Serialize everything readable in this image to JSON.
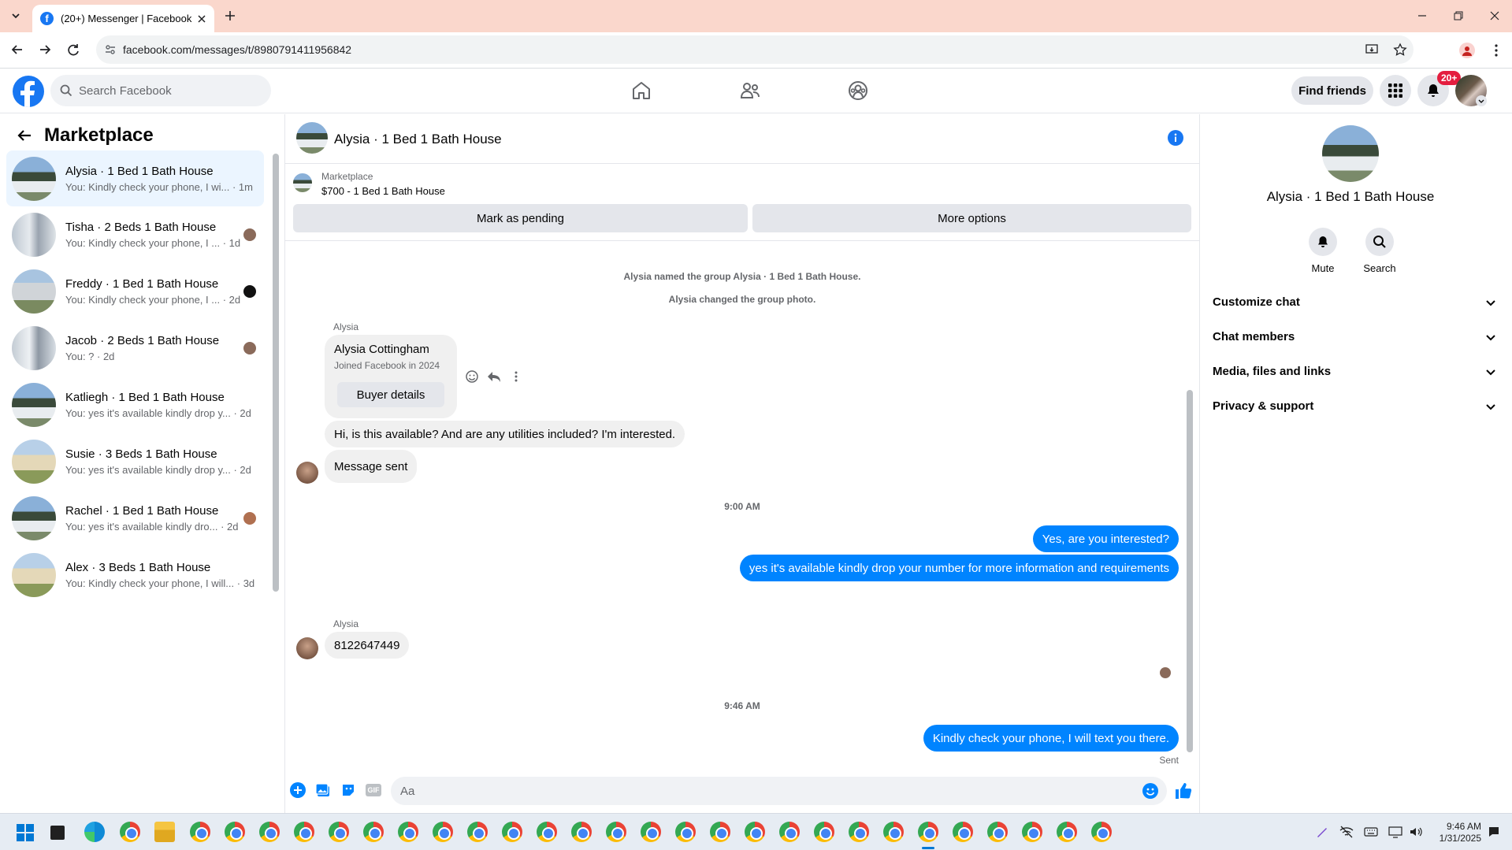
{
  "browser": {
    "tab_title": "(20+) Messenger | Facebook",
    "url": "facebook.com/messages/t/8980791411956842"
  },
  "header": {
    "search_placeholder": "Search Facebook",
    "find_friends": "Find friends",
    "notif_badge": "20+"
  },
  "sidebar": {
    "title": "Marketplace",
    "conversations": [
      {
        "name": "Alysia · 1 Bed 1 Bath House",
        "preview": "You: Kindly check your phone, I wi... · 1m",
        "selected": true
      },
      {
        "name": "Tisha · 2 Beds 1 Bath House",
        "preview": "You: Kindly check your phone, I ... · 1d"
      },
      {
        "name": "Freddy · 1 Bed 1 Bath House",
        "preview": "You: Kindly check your phone, I ... · 2d"
      },
      {
        "name": "Jacob · 2 Beds 1 Bath House",
        "preview": "You: ? · 2d"
      },
      {
        "name": "Katliegh · 1 Bed 1 Bath House",
        "preview": "You: yes it's available kindly drop y...  · 2d"
      },
      {
        "name": "Susie · 3 Beds 1 Bath House",
        "preview": "You: yes it's available kindly drop y...  · 2d"
      },
      {
        "name": "Rachel · 1 Bed 1 Bath House",
        "preview": "You: yes it's available kindly dro...  · 2d"
      },
      {
        "name": "Alex · 3 Beds 1 Bath House",
        "preview": "You: Kindly check your phone, I will... · 3d"
      }
    ]
  },
  "chat": {
    "title": "Alysia · 1 Bed 1 Bath House",
    "listing_source": "Marketplace",
    "listing_title": "$700 - 1 Bed 1 Bath House",
    "mark_pending": "Mark as pending",
    "more_options": "More options",
    "system_1": "Alysia named the group Alysia · 1 Bed 1 Bath House.",
    "system_2": "Alysia changed the group photo.",
    "sender_1": "Alysia",
    "card_name": "Alysia Cottingham",
    "card_sub": "Joined Facebook in 2024",
    "card_button": "Buyer details",
    "msg_in_1": "Hi, is this available? And are any utilities included? I'm interested.",
    "msg_in_2": "Message sent",
    "time_1": "9:00 AM",
    "msg_out_1": "Yes, are you interested?",
    "msg_out_2": "yes it's available kindly drop your number for more information and requirements",
    "sender_2": "Alysia",
    "msg_in_3": "8122647449",
    "time_2": "9:46 AM",
    "msg_out_3": "Kindly check your phone, I will text you there.",
    "sent_label": "Sent",
    "composer_placeholder": "Aa"
  },
  "details": {
    "title": "Alysia · 1 Bed 1 Bath House",
    "mute": "Mute",
    "search": "Search",
    "sections": [
      "Customize chat",
      "Chat members",
      "Media, files and links",
      "Privacy & support"
    ]
  },
  "taskbar": {
    "time": "9:46 AM",
    "date": "1/31/2025"
  },
  "colors": {
    "fb_blue": "#1877f2",
    "outgoing_bubble": "#0084ff",
    "incoming_bubble": "#f0f0f0",
    "selected_row": "#ebf5ff",
    "tab_strip": "#fad7cc"
  }
}
